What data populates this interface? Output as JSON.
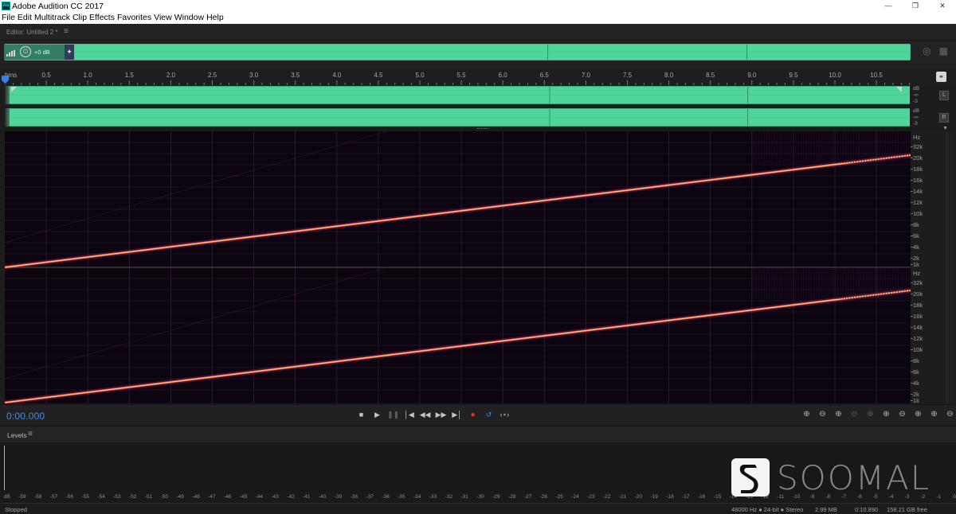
{
  "window": {
    "title": "Adobe Audition CC 2017",
    "icon_text": "Au",
    "controls": [
      "minimize-icon",
      "maximize-icon",
      "close-icon"
    ]
  },
  "menu": [
    "File",
    "Edit",
    "Multitrack",
    "Clip",
    "Effects",
    "Favorites",
    "View",
    "Window",
    "Help"
  ],
  "editor": {
    "panel_label": "Editor: Untitled 2 *",
    "gain_label": "+0 dB",
    "overview_right_icons": [
      "target-icon",
      "grid-icon"
    ]
  },
  "ruler": {
    "unit_label": "hms",
    "ticks": [
      "0.5",
      "1.0",
      "1.5",
      "2.0",
      "2.5",
      "3.0",
      "3.5",
      "4.0",
      "4.5",
      "5.0",
      "5.5",
      "6.0",
      "6.5",
      "7.0",
      "7.5",
      "8.0",
      "8.5",
      "9.0",
      "9.5",
      "10.0",
      "10.5"
    ]
  },
  "channels": {
    "left": {
      "db_unit": "dB",
      "db_values": [
        "-∞",
        "-3"
      ],
      "button": "L"
    },
    "right": {
      "db_unit": "dB",
      "db_values": [
        "-∞",
        "-3"
      ],
      "button": "R"
    }
  },
  "spectral": {
    "hz_unit": "Hz",
    "hz_labels": [
      "32k",
      "20k",
      "18k",
      "16k",
      "14k",
      "12k",
      "10k",
      "8k",
      "6k",
      "4k",
      "2k",
      "1k"
    ],
    "sweep_color": "#ffd58a"
  },
  "transport": {
    "time": "0:00.000",
    "buttons": [
      "stop-icon",
      "play-icon",
      "pause-icon",
      "go-to-start-icon",
      "rewind-icon",
      "fast-forward-icon",
      "go-to-end-icon",
      "record-icon",
      "loop-icon",
      "skip-selection-icon"
    ],
    "zoom_buttons": [
      "zoom-in-amplitude-icon",
      "zoom-out-amplitude-icon",
      "zoom-in-time-icon",
      "zoom-out-time-icon",
      "zoom-reset-icon",
      "zoom-in-point-icon",
      "zoom-out-point-icon",
      "zoom-selection-icon",
      "zoom-full-icon",
      "zoom-fit-icon"
    ]
  },
  "levels": {
    "panel_label": "Levels",
    "scale": [
      "dB",
      "-59",
      "-58",
      "-57",
      "-56",
      "-55",
      "-54",
      "-53",
      "-52",
      "-51",
      "-50",
      "-49",
      "-48",
      "-47",
      "-46",
      "-45",
      "-44",
      "-43",
      "-42",
      "-41",
      "-40",
      "-39",
      "-38",
      "-37",
      "-36",
      "-35",
      "-34",
      "-33",
      "-32",
      "-31",
      "-30",
      "-29",
      "-28",
      "-27",
      "-26",
      "-25",
      "-24",
      "-23",
      "-22",
      "-21",
      "-20",
      "-19",
      "-18",
      "-17",
      "-16",
      "-15",
      "-14",
      "-13",
      "-12",
      "-11",
      "-10",
      "-9",
      "-8",
      "-7",
      "-6",
      "-5",
      "-4",
      "-3",
      "-2",
      "-1",
      "0"
    ]
  },
  "watermark": {
    "text": "SOOMAL"
  },
  "status": {
    "state": "Stopped",
    "format": "48000 Hz ● 24-bit ● Stereo",
    "size": "2.99 MB",
    "duration": "0:10.890",
    "free": "158.21 GB free"
  },
  "colors": {
    "waveform": "#4fd59b",
    "accent_blue": "#3d8ce6",
    "record_red": "#e0352b"
  }
}
